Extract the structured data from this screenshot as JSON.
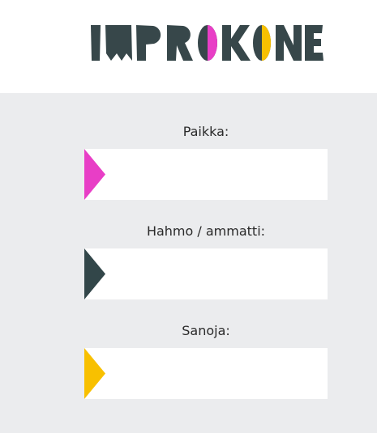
{
  "brand": {
    "logo_text": "IMPROKONE",
    "colors": {
      "dark": "#37474a",
      "pink": "#e83ec6",
      "yellow": "#f8c000"
    }
  },
  "fields": [
    {
      "label": "Paikka:",
      "value": "",
      "marker_color": "#e83ec6",
      "icon": "triangle-right-icon"
    },
    {
      "label": "Hahmo / ammatti:",
      "value": "",
      "marker_color": "#324649",
      "icon": "triangle-right-icon"
    },
    {
      "label": "Sanoja:",
      "value": "",
      "marker_color": "#f8c000",
      "icon": "triangle-right-icon"
    }
  ],
  "colors": {
    "background": "#ebecee",
    "header": "#ffffff",
    "field": "#ffffff",
    "text": "#2a2a2a"
  }
}
